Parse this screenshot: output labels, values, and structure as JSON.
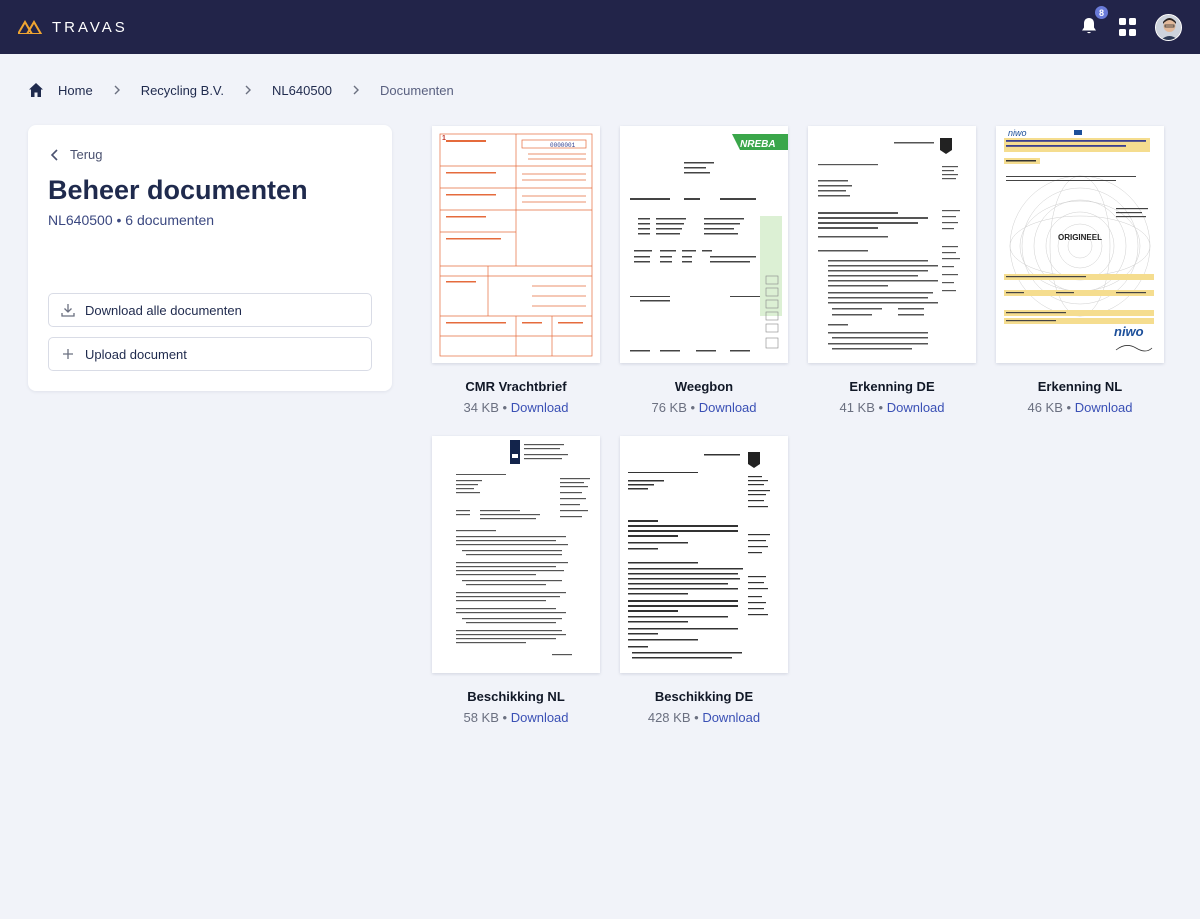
{
  "brand": {
    "name": "TRAVAS"
  },
  "topbar": {
    "notification_count": "8"
  },
  "breadcrumb": {
    "items": [
      "Home",
      "Recycling B.V.",
      "NL640500",
      "Documenten"
    ]
  },
  "panel": {
    "back_label": "Terug",
    "title": "Beheer documenten",
    "subtitle": "NL640500 • 6 documenten",
    "download_all_label": "Download alle documenten",
    "upload_label": "Upload document"
  },
  "documents": [
    {
      "name": "CMR Vrachtbrief",
      "size": "34 KB",
      "sep": "•",
      "download_label": "Download"
    },
    {
      "name": "Weegbon",
      "size": "76 KB",
      "sep": "•",
      "download_label": "Download"
    },
    {
      "name": "Erkenning DE",
      "size": "41 KB",
      "sep": "•",
      "download_label": "Download"
    },
    {
      "name": "Erkenning NL",
      "size": "46 KB",
      "sep": "•",
      "download_label": "Download"
    },
    {
      "name": "Beschikking NL",
      "size": "58 KB",
      "sep": "•",
      "download_label": "Download"
    },
    {
      "name": "Beschikking DE",
      "size": "428 KB",
      "sep": "•",
      "download_label": "Download"
    }
  ],
  "thumbnail_text": {
    "cmr_number": "0000001",
    "weegbon_logo": "NREBA",
    "erkenning_nl_logo": "niwo",
    "erkenning_nl_stamp": "ORIGINEEL"
  },
  "colors": {
    "topbar": "#222449",
    "accent": "#3a50b5",
    "badge": "#6a7bd8",
    "background": "#f1f3f9",
    "brand_orange": "#f0a531"
  },
  "icons": {
    "brand": "travas-logo-icon",
    "notifications": "bell-icon",
    "apps": "apps-grid-icon",
    "home": "home-icon",
    "separator": "chevron-right-icon",
    "back": "chevron-left-icon",
    "download": "download-icon",
    "upload": "plus-icon"
  }
}
